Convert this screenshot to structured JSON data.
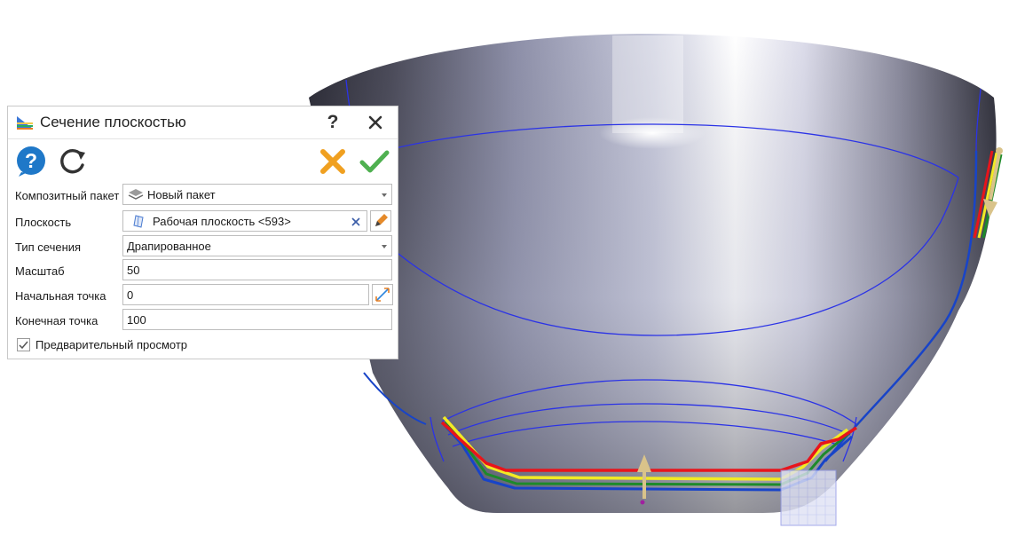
{
  "dialog": {
    "title": "Сечение плоскостью",
    "help_glyph": "?",
    "fields": {
      "composite_package": {
        "label": "Композитный пакет",
        "value": "Новый пакет"
      },
      "plane": {
        "label": "Плоскость",
        "value": "Рабочая плоскость <593>"
      },
      "section_type": {
        "label": "Тип сечения",
        "value": "Драпированное"
      },
      "scale": {
        "label": "Масштаб",
        "value": "50"
      },
      "start_point": {
        "label": "Начальная точка",
        "value": "0"
      },
      "end_point": {
        "label": "Конечная точка",
        "value": "100"
      }
    },
    "preview": {
      "label": "Предварительный просмотр",
      "checked": true
    }
  },
  "icons": {
    "title": "section-icon",
    "help": "help-bubble-icon",
    "refresh": "refresh-icon",
    "cancel": "cancel-x-icon",
    "ok": "checkmark-icon",
    "package": "layer-stack-icon",
    "plane": "plane-icon",
    "clear": "clear-selection-icon",
    "edit": "pencil-icon",
    "pick": "pick-point-icon"
  },
  "colors": {
    "curve_blue": "#2b33e6",
    "ply_red": "#e8141b",
    "ply_yellow": "#f2ea24",
    "ply_green": "#1d8a2a",
    "ply_blue": "#1844c8",
    "help_blue": "#1f78c8",
    "cancel_orange": "#f0a020",
    "ok_green": "#4fb050"
  }
}
